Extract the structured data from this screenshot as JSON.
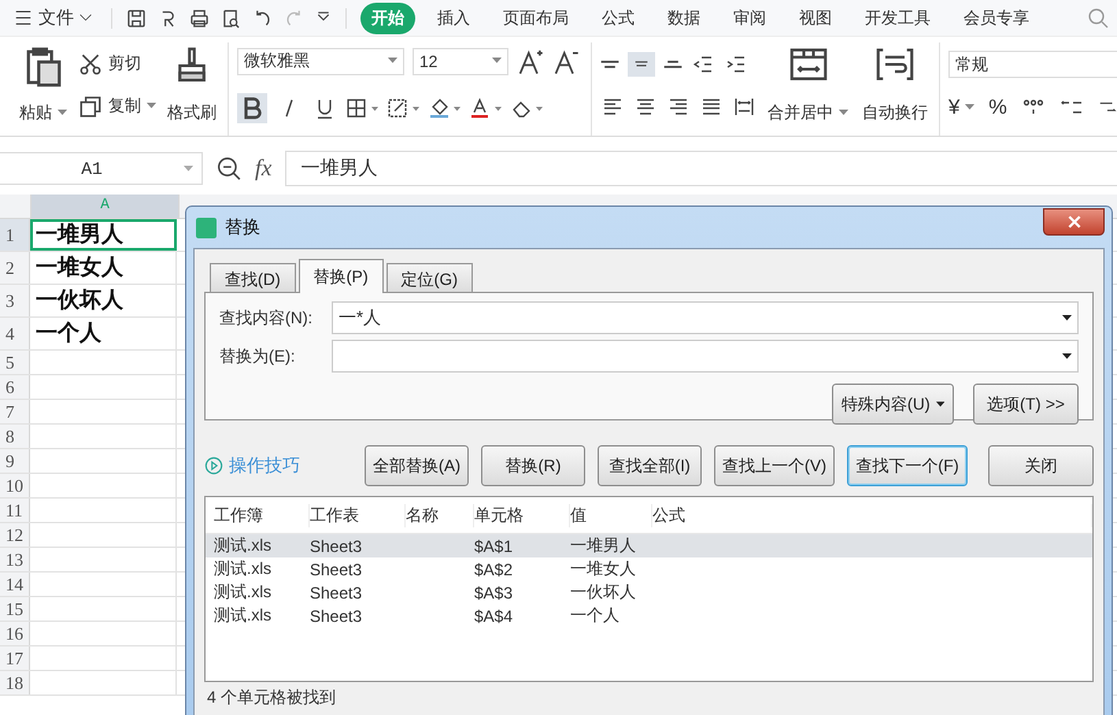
{
  "menu_bar": {
    "file_menu": "文件",
    "tabs": [
      {
        "label": "开始",
        "selected": true
      },
      {
        "label": "插入",
        "selected": false
      },
      {
        "label": "页面布局",
        "selected": false
      },
      {
        "label": "公式",
        "selected": false
      },
      {
        "label": "数据",
        "selected": false
      },
      {
        "label": "审阅",
        "selected": false
      },
      {
        "label": "视图",
        "selected": false
      },
      {
        "label": "开发工具",
        "selected": false
      },
      {
        "label": "会员专享",
        "selected": false
      }
    ]
  },
  "ribbon": {
    "paste": "粘贴",
    "cut": "剪切",
    "copy": "复制",
    "format_painter": "格式刷",
    "font_name": "微软雅黑",
    "font_size": "12",
    "bold": true,
    "middle_align": true,
    "merge": "合并居中",
    "wrap": "自动换行",
    "number_format": "常规",
    "currency": "¥",
    "percent": "%"
  },
  "formula_bar": {
    "name_box": "A1",
    "fx_label": "fx",
    "formula": "一堆男人"
  },
  "sheet": {
    "columns": [
      {
        "label": "A",
        "selected": true
      }
    ],
    "rows": [
      {
        "number": "1",
        "value": "一堆男人",
        "selected": true
      },
      {
        "number": "2",
        "value": "一堆女人",
        "selected": false
      },
      {
        "number": "3",
        "value": "一伙坏人",
        "selected": false
      },
      {
        "number": "4",
        "value": "一个人",
        "selected": false
      },
      {
        "number": "5",
        "selected": false
      },
      {
        "number": "6",
        "selected": false
      },
      {
        "number": "7",
        "selected": false
      },
      {
        "number": "8",
        "selected": false
      },
      {
        "number": "9",
        "selected": false
      },
      {
        "number": "10",
        "selected": false
      },
      {
        "number": "11",
        "selected": false
      },
      {
        "number": "12",
        "selected": false
      },
      {
        "number": "13",
        "selected": false
      },
      {
        "number": "14",
        "selected": false
      },
      {
        "number": "15",
        "selected": false
      },
      {
        "number": "16",
        "selected": false
      },
      {
        "number": "17",
        "selected": false
      },
      {
        "number": "18",
        "selected": false
      }
    ]
  },
  "dialog": {
    "title": "替换",
    "tabs": [
      {
        "label": "查找(D)",
        "selected": false
      },
      {
        "label": "替换(P)",
        "selected": true
      },
      {
        "label": "定位(G)",
        "selected": false
      }
    ],
    "find_label": "查找内容(N):",
    "find_value": "一*人",
    "replace_label": "替换为(E):",
    "special_button": "特殊内容(U)",
    "options_button": "选项(T) >>",
    "tips_link": "操作技巧",
    "actions": [
      {
        "label": "全部替换(A)",
        "focused": false
      },
      {
        "label": "替换(R)",
        "focused": false
      },
      {
        "label": "查找全部(I)",
        "focused": false
      },
      {
        "label": "查找上一个(V)",
        "focused": false
      },
      {
        "label": "查找下一个(F)",
        "focused": true
      }
    ],
    "close_button": "关闭",
    "results": {
      "columns": [
        "工作簿",
        "工作表",
        "名称",
        "单元格",
        "值",
        "公式"
      ],
      "rows": [
        {
          "workbook": "测试.xls",
          "sheet": "Sheet3",
          "cell": "$A$1",
          "value": "一堆男人",
          "selected": true
        },
        {
          "workbook": "测试.xls",
          "sheet": "Sheet3",
          "cell": "$A$2",
          "value": "一堆女人",
          "selected": false
        },
        {
          "workbook": "测试.xls",
          "sheet": "Sheet3",
          "cell": "$A$3",
          "value": "一伙坏人",
          "selected": false
        },
        {
          "workbook": "测试.xls",
          "sheet": "Sheet3",
          "cell": "$A$4",
          "value": "一个人",
          "selected": false
        }
      ]
    },
    "status": "4 个单元格被找到"
  }
}
